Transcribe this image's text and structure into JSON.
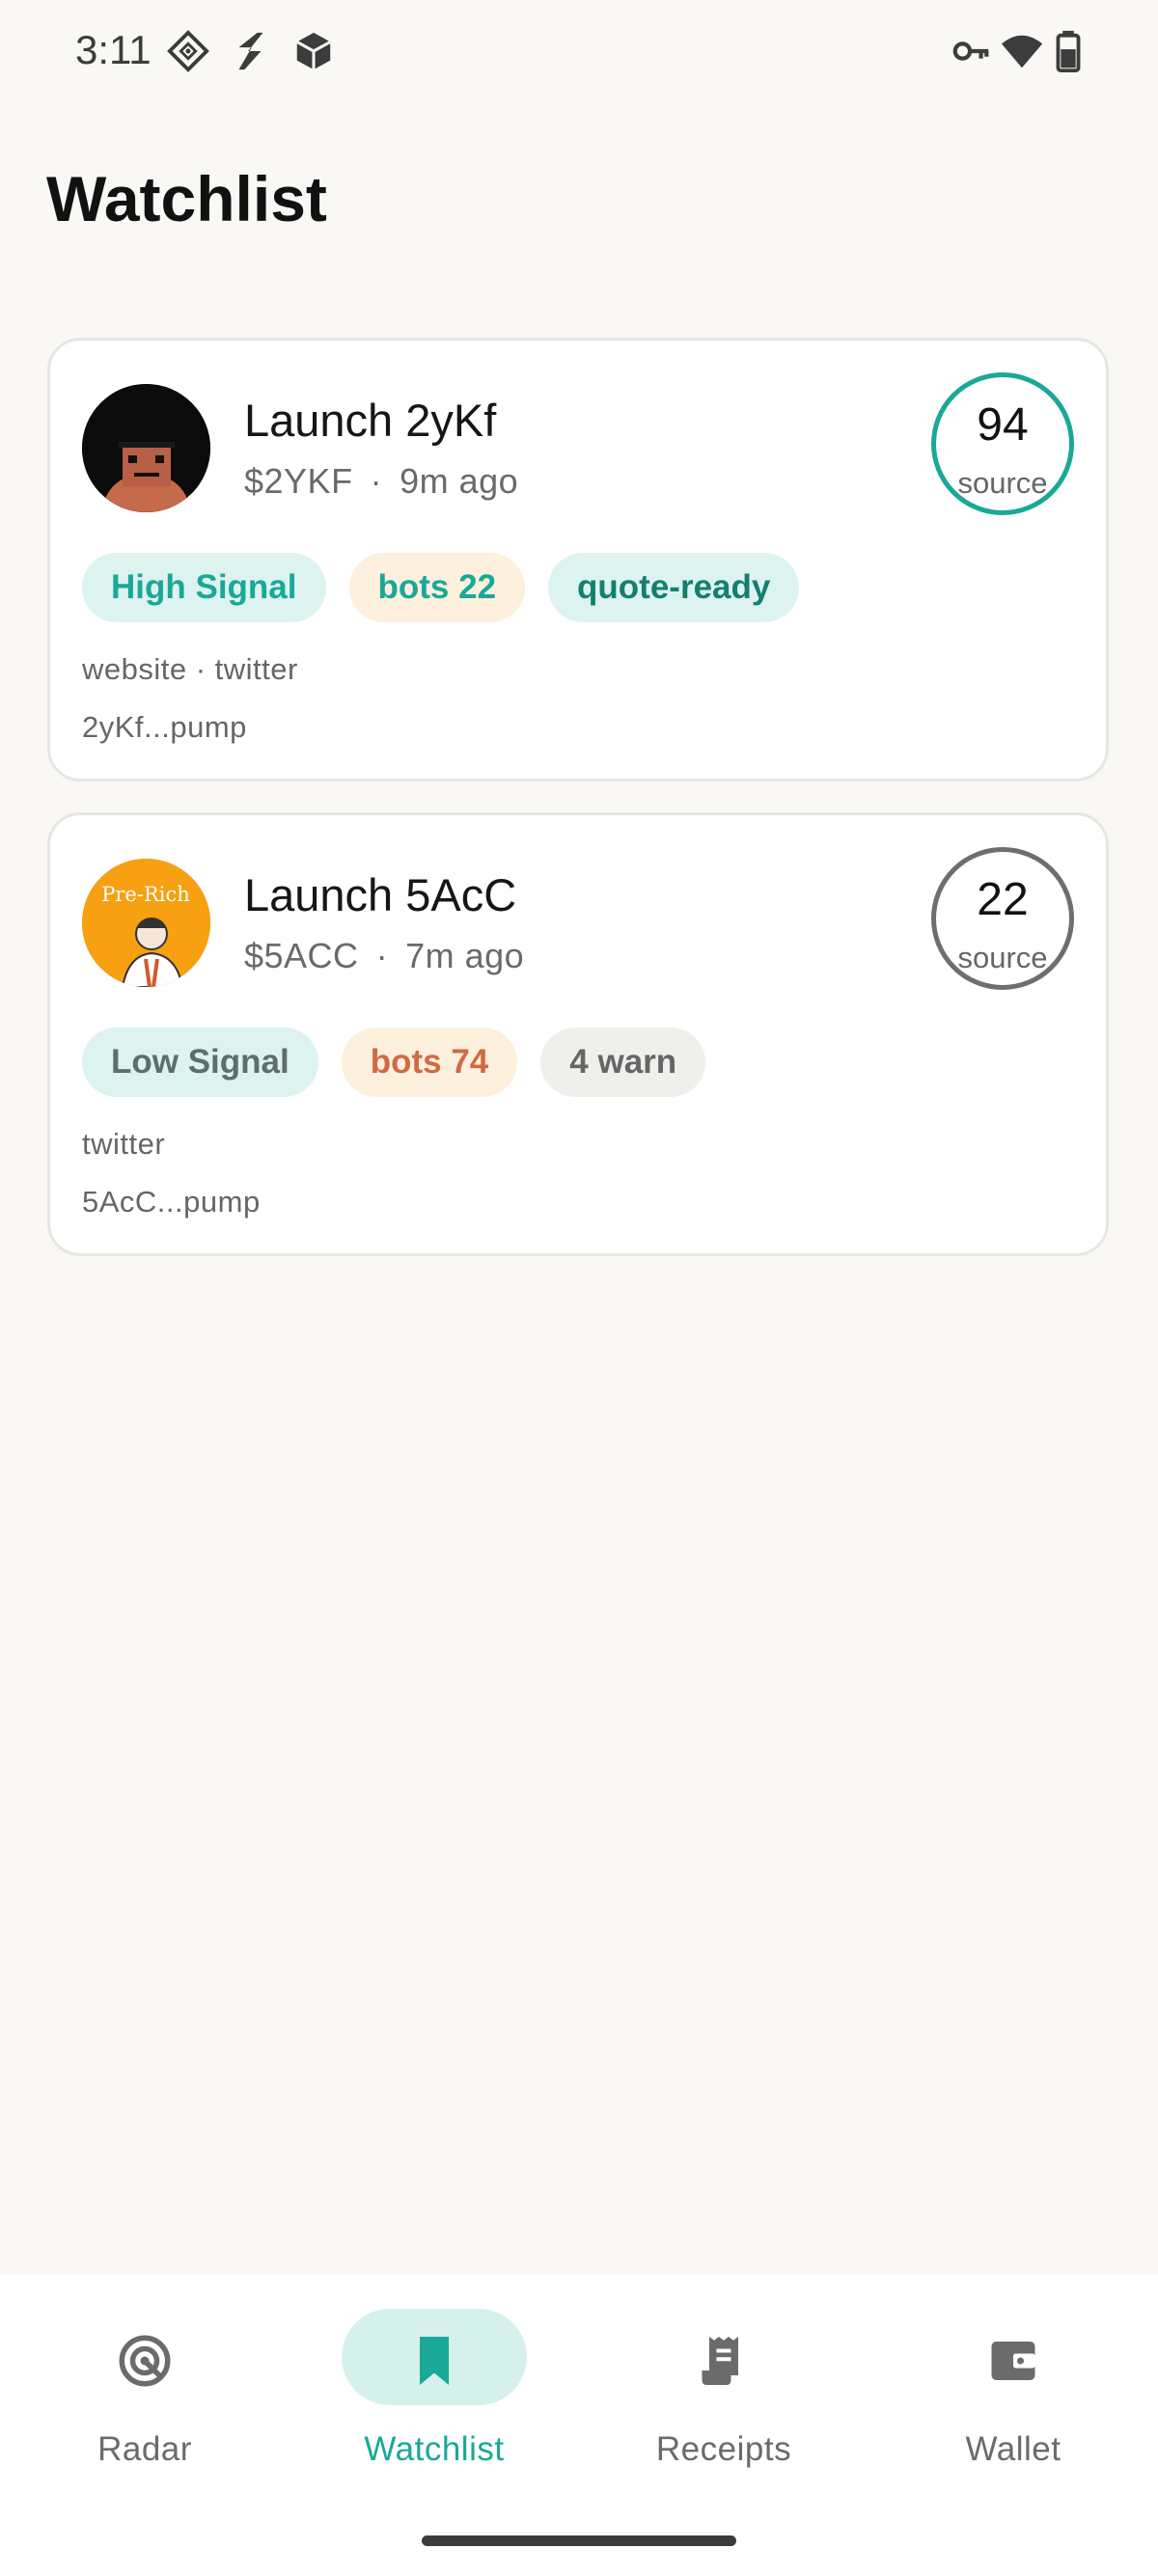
{
  "status_bar": {
    "time": "3:11",
    "left_icons": [
      "grid-diamond-icon",
      "bolt-icon",
      "cube-icon"
    ],
    "right_icons": [
      "vpn-key-icon",
      "wifi-icon",
      "battery-icon"
    ]
  },
  "page": {
    "title": "Watchlist"
  },
  "colors": {
    "accent": "#1aa898",
    "background": "#faf8f5",
    "high_signal_bg": "#ddf3ef",
    "bots_bg": "#fdf0dd",
    "bots_high_text": "#d06a45",
    "neutral_chip_bg": "#efefec"
  },
  "cards": [
    {
      "title": "Launch 2yKf",
      "ticker": "$2YKF",
      "separator": "·",
      "age": "9m ago",
      "score": "94",
      "score_label": "source",
      "chips": [
        "High Signal",
        "bots 22",
        "quote-ready"
      ],
      "links": "website · twitter",
      "address": "2yKf...pump"
    },
    {
      "title": "Launch 5AcC",
      "ticker": "$5ACC",
      "separator": "·",
      "age": "7m ago",
      "score": "22",
      "score_label": "source",
      "chips": [
        "Low Signal",
        "bots 74",
        "4 warn"
      ],
      "links": "twitter",
      "address": "5AcC...pump",
      "avatar_text": "Pre-Rich"
    }
  ],
  "bottom_nav": {
    "items": [
      {
        "label": "Radar",
        "icon": "radar-icon"
      },
      {
        "label": "Watchlist",
        "icon": "bookmark-icon"
      },
      {
        "label": "Receipts",
        "icon": "receipt-icon"
      },
      {
        "label": "Wallet",
        "icon": "wallet-icon"
      }
    ],
    "active": "Watchlist"
  }
}
